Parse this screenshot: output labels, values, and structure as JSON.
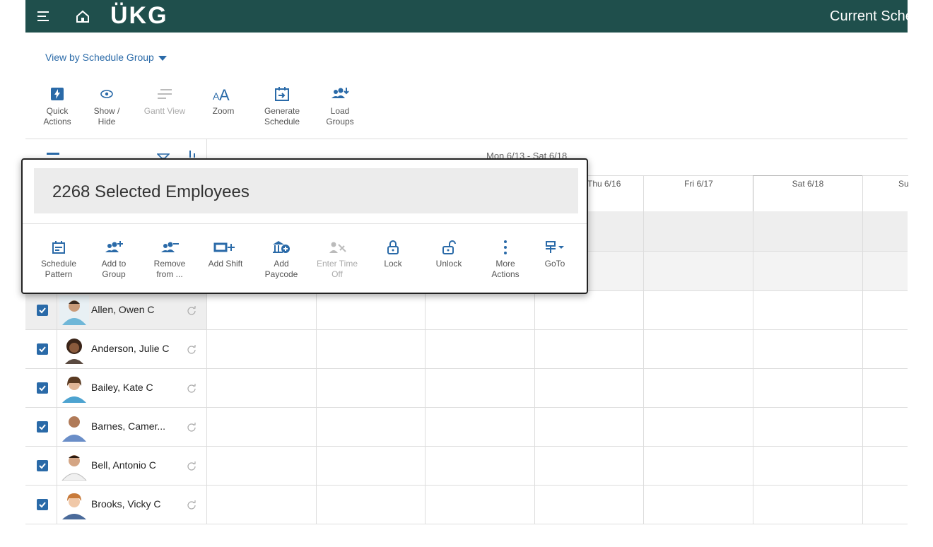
{
  "header": {
    "logo": "ÜKG",
    "page_title": "Current Schedule"
  },
  "view_by": {
    "label": "View by Schedule Group"
  },
  "toolbar": {
    "items": [
      {
        "label_1": "Quick",
        "label_2": "Actions",
        "icon": "lightning-icon"
      },
      {
        "label_1": "Show /",
        "label_2": "Hide",
        "icon": "eye-icon"
      },
      {
        "label_1": "Gantt View",
        "label_2": "",
        "icon": "gantt-icon",
        "disabled": true
      },
      {
        "label_1": "Zoom",
        "label_2": "",
        "icon": "zoom-text-icon"
      },
      {
        "label_1": "Generate",
        "label_2": "Schedule",
        "icon": "calendar-generate-icon"
      },
      {
        "label_1": "Load",
        "label_2": "Groups",
        "icon": "load-groups-icon"
      }
    ]
  },
  "week": {
    "label": "Mon 6/13 - Sat 6/18"
  },
  "days": [
    {
      "label": "Thu 6/16"
    },
    {
      "label": "Fri 6/17"
    },
    {
      "label": "Sat 6/18"
    },
    {
      "label": "Su"
    }
  ],
  "popup": {
    "title": "2268 Selected Employees",
    "actions": [
      {
        "label_1": "Schedule",
        "label_2": "Pattern",
        "icon": "schedule-pattern-icon"
      },
      {
        "label_1": "Add to",
        "label_2": "Group",
        "icon": "add-to-group-icon"
      },
      {
        "label_1": "Remove",
        "label_2": "from ...",
        "icon": "remove-from-group-icon"
      },
      {
        "label_1": "Add Shift",
        "label_2": "",
        "icon": "add-shift-icon"
      },
      {
        "label_1": "Add",
        "label_2": "Paycode",
        "icon": "add-paycode-icon"
      },
      {
        "label_1": "Enter Time",
        "label_2": "Off",
        "icon": "time-off-icon",
        "disabled": true
      },
      {
        "label_1": "Lock",
        "label_2": "",
        "icon": "lock-icon"
      },
      {
        "label_1": "Unlock",
        "label_2": "",
        "icon": "unlock-icon"
      },
      {
        "label_1": "More",
        "label_2": "Actions",
        "icon": "more-vertical-icon"
      },
      {
        "label_1": "GoTo",
        "label_2": "",
        "icon": "goto-icon"
      }
    ]
  },
  "employees": [
    {
      "name": "Allen, Owen C",
      "checked": true
    },
    {
      "name": "Anderson, Julie C",
      "checked": true
    },
    {
      "name": "Bailey, Kate C",
      "checked": true
    },
    {
      "name": "Barnes, Camer...",
      "checked": true
    },
    {
      "name": "Bell, Antonio C",
      "checked": true
    },
    {
      "name": "Brooks, Vicky C",
      "checked": true
    }
  ],
  "colors": {
    "header_bg": "#1f4f4c",
    "link_blue": "#2a6aa8",
    "checkbox_blue": "#2a6aa8"
  }
}
